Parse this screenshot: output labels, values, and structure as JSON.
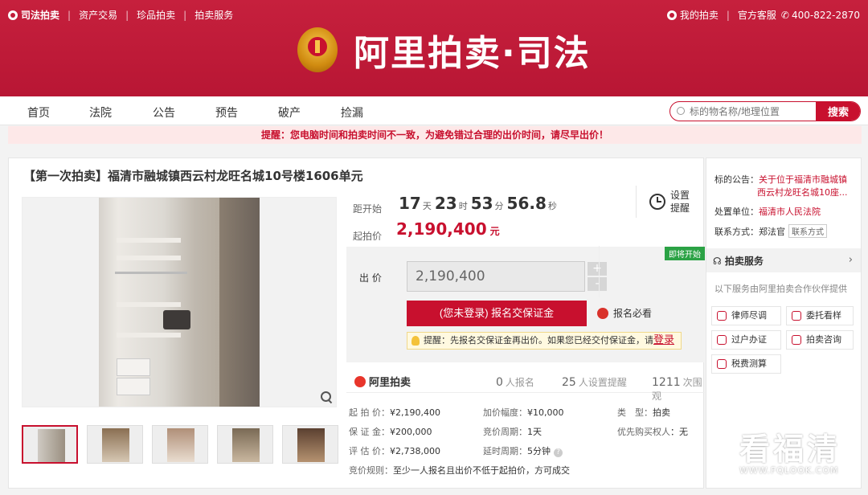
{
  "topbar": {
    "brand": "司法拍卖",
    "links": [
      "资产交易",
      "珍品拍卖",
      "拍卖服务"
    ],
    "my_auction": "我的拍卖",
    "service": "官方客服",
    "phone": "400-822-2870"
  },
  "logo": {
    "text": "阿里拍卖·司法"
  },
  "nav": {
    "items": [
      "首页",
      "法院",
      "公告",
      "预告",
      "破产",
      "捡漏"
    ]
  },
  "search": {
    "placeholder": "标的物名称/地理位置",
    "button": "搜索"
  },
  "notice": "提醒：您电脑时间和拍卖时间不一致，为避免错过合理的出价时间，请尽早出价！",
  "item": {
    "title": "【第一次拍卖】福清市融城镇西云村龙旺名城10号楼1606单元",
    "countdown_label": "距开始",
    "countdown": {
      "days": "17",
      "days_unit": "天",
      "hours": "23",
      "hours_unit": "时",
      "minutes": "53",
      "minutes_unit": "分",
      "seconds": "56.8",
      "seconds_unit": "秒"
    },
    "start_label": "起拍价",
    "start_price": "2,190,400",
    "start_unit": "元",
    "remind": {
      "line1": "设置",
      "line2": "提醒"
    }
  },
  "bid": {
    "tag": "即将开始",
    "label": "出 价",
    "value": "2,190,400",
    "plus": "+",
    "minus": "-",
    "deposit_button": "(您未登录) 报名交保证金",
    "must_read": "报名必看",
    "tip_text": "提醒：先报名交保证金再出价。如果您已经交付保证金，请",
    "tip_login": "登录"
  },
  "stats": {
    "platform": "阿里拍卖",
    "signed_count": "0",
    "signed_label": "人报名",
    "remind_count": "25",
    "remind_label": "人设置提醒",
    "view_count": "1211",
    "view_label": "次围观"
  },
  "details": {
    "start_price_k": "起 拍 价：",
    "start_price_v": "¥2,190,400",
    "increment_k": "加价幅度：",
    "increment_v": "¥10,000",
    "type_k": "类　型：",
    "type_v": "拍卖",
    "deposit_k": "保 证 金：",
    "deposit_v": "¥200,000",
    "period_k": "竞价周期：",
    "period_v": "1天",
    "priority_k": "优先购买权人",
    "priority_v": "：无",
    "appraisal_k": "评 估 价：",
    "appraisal_v": "¥2,738,000",
    "delay_k": "延时周期：",
    "delay_v": "5分钟",
    "rule_k": "竞价规则：",
    "rule_v": "至少一人报名且出价不低于起拍价，方可成交"
  },
  "side": {
    "notice_k": "标的公告：",
    "notice_v1": "关于位于福清市融城镇",
    "notice_v2": "西云村龙旺名城10座...",
    "unit_k": "处置单位：",
    "unit_v": "福清市人民法院",
    "contact_k": "联系方式：",
    "contact_v": "郑法官",
    "contact_btn": "联系方式",
    "service_title": "拍卖服务",
    "service_desc": "以下服务由阿里拍卖合作伙伴提供",
    "services": [
      "律师尽调",
      "委托看样",
      "过户办证",
      "拍卖咨询",
      "税费测算"
    ]
  },
  "watermark": {
    "big": "看福清",
    "small": "WWW.FQLOOK.COM"
  },
  "colors": {
    "brand_red": "#c8102e",
    "header_red": "#c21b38",
    "tag_green": "#2ba245"
  }
}
